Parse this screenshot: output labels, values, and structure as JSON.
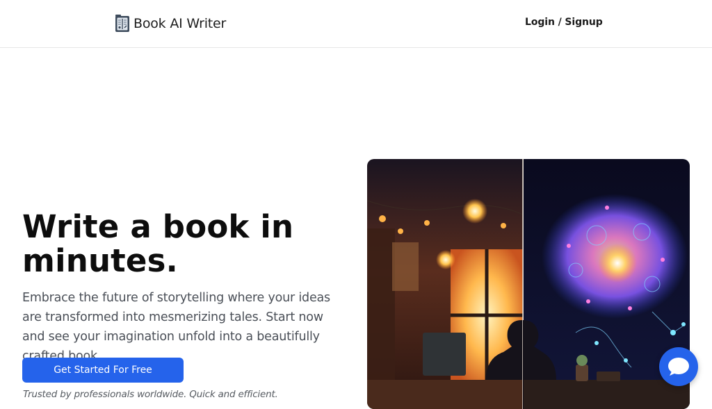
{
  "header": {
    "brand_name": "Book AI Writer",
    "brand_icon": "book-logo-icon",
    "login_label": "Login / Signup"
  },
  "hero": {
    "title_line1": "Write a book in",
    "title_line2": "minutes.",
    "description": "Embrace the future of storytelling where your ideas are transformed into mesmerizing tales. Start now and see your imagination unfold into a beautifully crafted book.",
    "cta_label": "Get Started For Free",
    "trusted_text": "Trusted by professionals worldwide. Quick and efficient."
  },
  "chat": {
    "icon": "chat-bubble-icon"
  },
  "colors": {
    "accent": "#2563eb",
    "heading": "#0d0d0d",
    "body_text": "#4a4f57"
  }
}
